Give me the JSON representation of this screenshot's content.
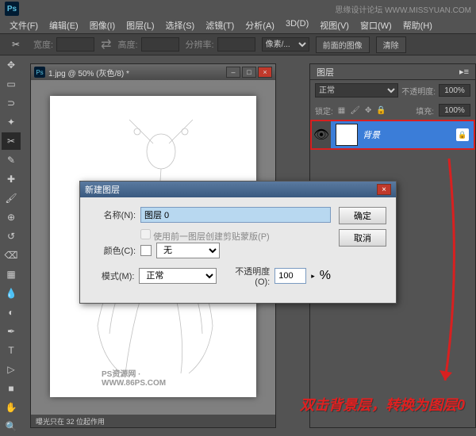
{
  "app": {
    "name": "Ps",
    "right_text": "思缘设计论坛 WWW.MISSYUAN.COM"
  },
  "menu": [
    "文件(F)",
    "编辑(E)",
    "图像(I)",
    "图层(L)",
    "选择(S)",
    "滤镜(T)",
    "分析(A)",
    "3D(D)",
    "视图(V)",
    "窗口(W)",
    "帮助(H)"
  ],
  "optbar": {
    "width_label": "宽度:",
    "height_label": "高度:",
    "res_label": "分辨率:",
    "pixels_label": "像素/...",
    "front_img": "前面的图像",
    "clear": "清除"
  },
  "doc": {
    "title": "1.jpg @ 50% (灰色/8) *",
    "status": "曝光只在 32 位起作用",
    "watermark": "PS资源网 · WWW.86PS.COM"
  },
  "layers": {
    "tab": "图层",
    "blend": "正常",
    "opacity_label": "不透明度:",
    "opacity": "100%",
    "lock_label": "锁定:",
    "fill_label": "填充:",
    "fill": "100%",
    "layer_name": "背景"
  },
  "dialog": {
    "title": "新建图层",
    "name_label": "名称(N):",
    "name_value": "图层 0",
    "clip_check": "使用前一图层创建剪贴蒙版(P)",
    "color_label": "颜色(C):",
    "color_value": "无",
    "mode_label": "模式(M):",
    "mode_value": "正常",
    "opacity_label": "不透明度(O):",
    "opacity_value": "100",
    "percent": "%",
    "ok": "确定",
    "cancel": "取消"
  },
  "annotation": "双击背景层，转换为图层0"
}
